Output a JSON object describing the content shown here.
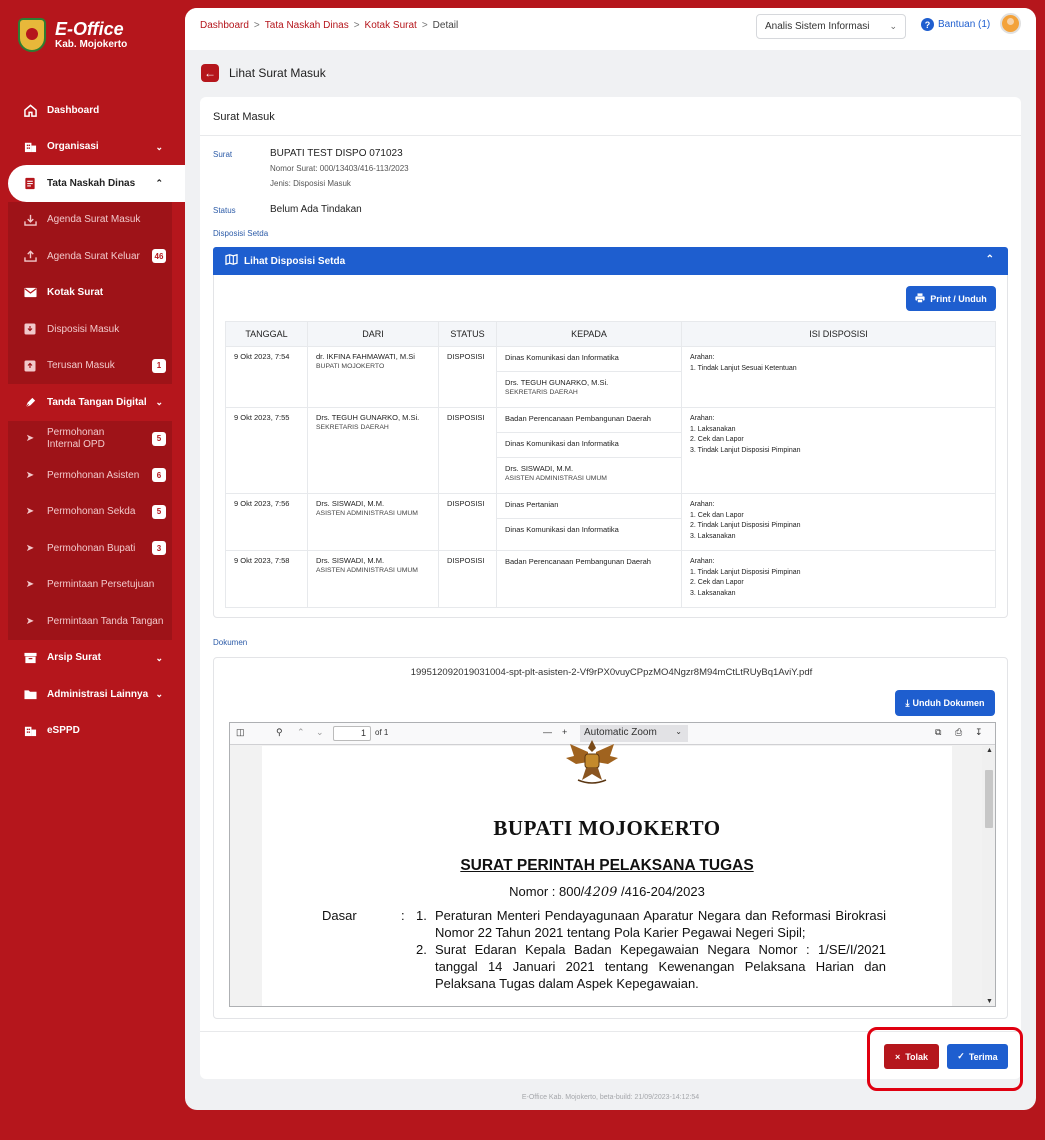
{
  "brand": {
    "title": "E-Office",
    "subtitle": "Kab. Mojokerto"
  },
  "sidebar": {
    "items": [
      {
        "label": "Dashboard",
        "icon": "home-icon"
      },
      {
        "label": "Organisasi",
        "icon": "building-icon"
      },
      {
        "label": "Tata Naskah Dinas",
        "icon": "document-icon",
        "active": true
      },
      {
        "label": "Tanda Tangan Digital",
        "icon": "pen-icon"
      },
      {
        "label": "Arsip Surat",
        "icon": "archive-icon"
      },
      {
        "label": "Administrasi Lainnya",
        "icon": "folder-icon"
      },
      {
        "label": "eSPPD",
        "icon": "building-icon"
      }
    ],
    "tnd_sub": [
      {
        "label": "Agenda Surat Masuk",
        "icon": "inbox-download-icon"
      },
      {
        "label": "Agenda Surat Keluar",
        "icon": "outbox-upload-icon",
        "badge": "46"
      },
      {
        "label": "Kotak Surat",
        "icon": "mail-icon"
      },
      {
        "label": "Disposisi Masuk",
        "icon": "tray-icon"
      },
      {
        "label": "Terusan Masuk",
        "icon": "tray-icon",
        "badge": "1"
      }
    ],
    "ttd_sub": [
      {
        "label": "Permohonan Internal OPD",
        "badge": "5"
      },
      {
        "label": "Permohonan Asisten",
        "badge": "6"
      },
      {
        "label": "Permohonan Sekda",
        "badge": "5"
      },
      {
        "label": "Permohonan Bupati",
        "badge": "3"
      },
      {
        "label": "Permintaan Persetujuan"
      },
      {
        "label": "Permintaan Tanda Tangan"
      }
    ]
  },
  "header": {
    "breadcrumb": [
      "Dashboard",
      "Tata Naskah Dinas",
      "Kotak Surat",
      "Detail"
    ],
    "role": "Analis Sistem Informasi",
    "help": "Bantuan (1)"
  },
  "page": {
    "title": "Lihat Surat Masuk"
  },
  "card": {
    "title": "Surat Masuk",
    "surat_label": "Surat",
    "surat_title": "BUPATI TEST DISPO 071023",
    "nomor": "Nomor Surat: 000/13403/416-113/2023",
    "jenis": "Jenis: Disposisi Masuk",
    "status_label": "Status",
    "status_value": "Belum Ada Tindakan",
    "disposisi_label": "Disposisi Setda",
    "disposisi_header": "Lihat Disposisi Setda",
    "print_label": "Print / Unduh",
    "dokumen_label": "Dokumen"
  },
  "table": {
    "headers": [
      "TANGGAL",
      "DARI",
      "STATUS",
      "KEPADA",
      "ISI DISPOSISI"
    ],
    "rows": [
      {
        "tanggal": "9 Okt 2023, 7:54",
        "dari": "dr. IKFINA FAHMAWATI, M.Si",
        "dari_sub": "BUPATI MOJOKERTO",
        "status": "DISPOSISI",
        "kepada": [
          {
            "name": "Dinas Komunikasi dan Informatika",
            "sub": ""
          },
          {
            "name": "Drs. TEGUH GUNARKO, M.Si.",
            "sub": "SEKRETARIS DAERAH"
          }
        ],
        "isi": [
          "Arahan:",
          "1. Tindak Lanjut Sesuai Ketentuan"
        ]
      },
      {
        "tanggal": "9 Okt 2023, 7:55",
        "dari": "Drs. TEGUH GUNARKO, M.Si.",
        "dari_sub": "SEKRETARIS DAERAH",
        "status": "DISPOSISI",
        "kepada": [
          {
            "name": "Badan Perencanaan Pembangunan Daerah",
            "sub": ""
          },
          {
            "name": "Dinas Komunikasi dan Informatika",
            "sub": ""
          },
          {
            "name": "Drs. SISWADI, M.M.",
            "sub": "ASISTEN ADMINISTRASI UMUM"
          }
        ],
        "isi": [
          "Arahan:",
          "1. Laksanakan",
          "2. Cek dan Lapor",
          "3. Tindak Lanjut Disposisi Pimpinan"
        ]
      },
      {
        "tanggal": "9 Okt 2023, 7:56",
        "dari": "Drs. SISWADI, M.M.",
        "dari_sub": "ASISTEN ADMINISTRASI UMUM",
        "status": "DISPOSISI",
        "kepada": [
          {
            "name": "Dinas Pertanian",
            "sub": ""
          },
          {
            "name": "Dinas Komunikasi dan Informatika",
            "sub": ""
          }
        ],
        "isi": [
          "Arahan:",
          "1. Cek dan Lapor",
          "2. Tindak Lanjut Disposisi Pimpinan",
          "3. Laksanakan"
        ]
      },
      {
        "tanggal": "9 Okt 2023, 7:58",
        "dari": "Drs. SISWADI, M.M.",
        "dari_sub": "ASISTEN ADMINISTRASI UMUM",
        "status": "DISPOSISI",
        "kepada": [
          {
            "name": "Badan Perencanaan Pembangunan Daerah",
            "sub": ""
          }
        ],
        "isi": [
          "Arahan:",
          "1. Tindak Lanjut Disposisi Pimpinan",
          "2. Cek dan Lapor",
          "3. Laksanakan"
        ]
      }
    ]
  },
  "document": {
    "filename": "199512092019031004-spt-plt-asisten-2-Vf9rPX0vuyCPpzMO4Ngzr8M94mCtLtRUyBq1AviY.pdf",
    "download_label": "Unduh Dokumen",
    "viewer": {
      "page": "1",
      "of": "of 1",
      "zoom": "Automatic Zoom",
      "minus": "—",
      "plus": "+"
    },
    "content": {
      "heading": "BUPATI  MOJOKERTO",
      "subheading": "SURAT PERINTAH PELAKSANA TUGAS",
      "nomor_prefix": "Nomor  :  800/",
      "nomor_hand": "4209",
      "nomor_suffix": " /416-204/2023",
      "dasar_label": "Dasar",
      "colon": ":",
      "items": [
        {
          "num": "1.",
          "text": "Peraturan Menteri Pendayagunaan Aparatur Negara dan Reformasi Birokrasi Nomor 22 Tahun 2021 tentang Pola Karier Pegawai Negeri Sipil;"
        },
        {
          "num": "2.",
          "text": "Surat Edaran Kepala Badan Kepegawaian Negara Nomor : 1/SE/I/2021 tanggal 14 Januari 2021 tentang Kewenangan Pelaksana Harian dan Pelaksana Tugas dalam Aspek Kepegawaian."
        }
      ]
    }
  },
  "actions": {
    "tolak": "Tolak",
    "terima": "Terima"
  },
  "footer": "E-Office Kab. Mojokerto, beta-build: 21/09/2023-14:12:54",
  "colors": {
    "brand_red": "#b5161c",
    "primary_blue": "#1e5ecf",
    "highlight": "#e00010"
  }
}
